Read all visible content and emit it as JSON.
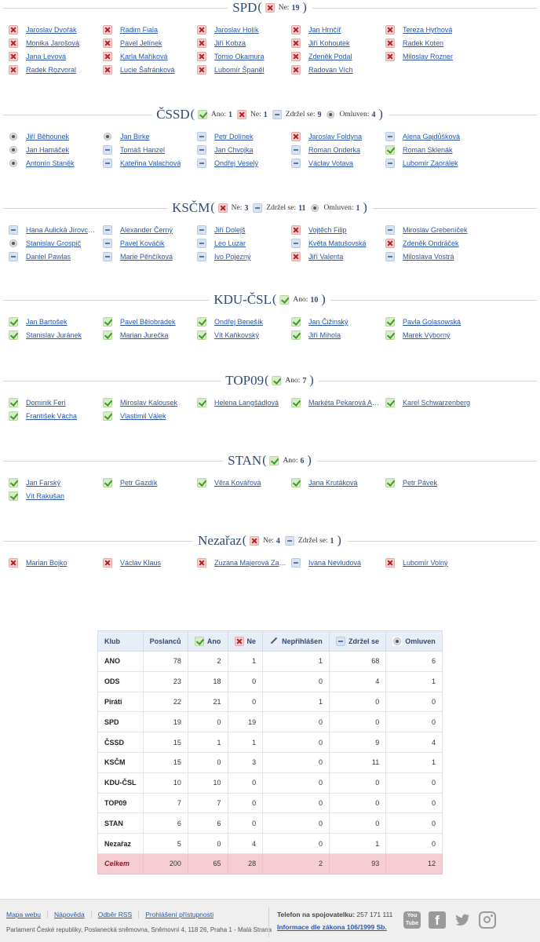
{
  "sections": [
    {
      "party": "SPD",
      "stats": [
        {
          "type": "no",
          "label": "Ne:",
          "value": "19"
        }
      ],
      "members": [
        {
          "name": "Jaroslav Dvořák",
          "vote": "no"
        },
        {
          "name": "Radim Fiala",
          "vote": "no"
        },
        {
          "name": "Jaroslav Holík",
          "vote": "no"
        },
        {
          "name": "Jan Hrnčíř",
          "vote": "no"
        },
        {
          "name": "Tereza Hyťhová",
          "vote": "no"
        },
        {
          "name": "Monika Jarošová",
          "vote": "no"
        },
        {
          "name": "Pavel Jelínek",
          "vote": "no"
        },
        {
          "name": "Jiří Kobza",
          "vote": "no"
        },
        {
          "name": "Jiří Kohoutek",
          "vote": "no"
        },
        {
          "name": "Radek Koten",
          "vote": "no"
        },
        {
          "name": "Jana Levová",
          "vote": "no"
        },
        {
          "name": "Karla Maříková",
          "vote": "no"
        },
        {
          "name": "Tomio Okamura",
          "vote": "no"
        },
        {
          "name": "Zdeněk Podal",
          "vote": "no"
        },
        {
          "name": "Miloslav Rozner",
          "vote": "no"
        },
        {
          "name": "Radek Rozvoral",
          "vote": "no"
        },
        {
          "name": "Lucie Šafránková",
          "vote": "no"
        },
        {
          "name": "Lubomír Španěl",
          "vote": "no"
        },
        {
          "name": "Radovan Vích",
          "vote": "no"
        }
      ]
    },
    {
      "party": "ČSSD",
      "stats": [
        {
          "type": "yes",
          "label": "Ano:",
          "value": "1"
        },
        {
          "type": "no",
          "label": "Ne:",
          "value": "1"
        },
        {
          "type": "abst",
          "label": "Zdržel se:",
          "value": "9"
        },
        {
          "type": "exc",
          "label": "Omluven:",
          "value": "4"
        }
      ],
      "members": [
        {
          "name": "Jiří Běhounek",
          "vote": "exc"
        },
        {
          "name": "Jan Birke",
          "vote": "exc"
        },
        {
          "name": "Petr Dolínek",
          "vote": "abst"
        },
        {
          "name": "Jaroslav Foldyna",
          "vote": "no"
        },
        {
          "name": "Alena Gajdůšková",
          "vote": "abst"
        },
        {
          "name": "Jan Hamáček",
          "vote": "exc"
        },
        {
          "name": "Tomáš Hanzel",
          "vote": "abst"
        },
        {
          "name": "Jan Chvojka",
          "vote": "abst"
        },
        {
          "name": "Roman Onderka",
          "vote": "abst"
        },
        {
          "name": "Roman Sklenák",
          "vote": "yes"
        },
        {
          "name": "Antonín Staněk",
          "vote": "exc"
        },
        {
          "name": "Kateřina Valachová",
          "vote": "abst"
        },
        {
          "name": "Ondřej Veselý",
          "vote": "abst"
        },
        {
          "name": "Václav Votava",
          "vote": "abst"
        },
        {
          "name": "Lubomír Zaorálek",
          "vote": "abst"
        }
      ]
    },
    {
      "party": "KSČM",
      "stats": [
        {
          "type": "no",
          "label": "Ne:",
          "value": "3"
        },
        {
          "type": "abst",
          "label": "Zdržel se:",
          "value": "11"
        },
        {
          "type": "exc",
          "label": "Omluven:",
          "value": "1"
        }
      ],
      "members": [
        {
          "name": "Hana Aulická Jírovcová",
          "vote": "abst"
        },
        {
          "name": "Alexander Černý",
          "vote": "abst"
        },
        {
          "name": "Jiří Dolejš",
          "vote": "abst"
        },
        {
          "name": "Vojtěch Filip",
          "vote": "no"
        },
        {
          "name": "Miroslav Grebeníček",
          "vote": "abst"
        },
        {
          "name": "Stanislav Grospič",
          "vote": "exc"
        },
        {
          "name": "Pavel Kováčik",
          "vote": "abst"
        },
        {
          "name": "Leo Luzar",
          "vote": "abst"
        },
        {
          "name": "Květa Matušovská",
          "vote": "abst"
        },
        {
          "name": "Zdeněk Ondráček",
          "vote": "no"
        },
        {
          "name": "Daniel Pawlas",
          "vote": "abst"
        },
        {
          "name": "Marie Pěnčíková",
          "vote": "abst"
        },
        {
          "name": "Ivo Pojezný",
          "vote": "abst"
        },
        {
          "name": "Jiří Valenta",
          "vote": "no"
        },
        {
          "name": "Miloslava Vostrá",
          "vote": "abst"
        }
      ]
    },
    {
      "party": "KDU-ČSL",
      "stats": [
        {
          "type": "yes",
          "label": "Ano:",
          "value": "10"
        }
      ],
      "members": [
        {
          "name": "Jan Bartošek",
          "vote": "yes"
        },
        {
          "name": "Pavel Bělobrádek",
          "vote": "yes"
        },
        {
          "name": "Ondřej Benešík",
          "vote": "yes"
        },
        {
          "name": "Jan Čižinský",
          "vote": "yes"
        },
        {
          "name": "Pavla Golasowská",
          "vote": "yes"
        },
        {
          "name": "Stanislav Juránek",
          "vote": "yes"
        },
        {
          "name": "Marian Jurečka",
          "vote": "yes"
        },
        {
          "name": "Vít Kaňkovský",
          "vote": "yes"
        },
        {
          "name": "Jiří Mihola",
          "vote": "yes"
        },
        {
          "name": "Marek Výborný",
          "vote": "yes"
        }
      ]
    },
    {
      "party": "TOP09",
      "stats": [
        {
          "type": "yes",
          "label": "Ano:",
          "value": "7"
        }
      ],
      "members": [
        {
          "name": "Dominik Feri",
          "vote": "yes"
        },
        {
          "name": "Miroslav Kalousek",
          "vote": "yes"
        },
        {
          "name": "Helena Langšádlová",
          "vote": "yes"
        },
        {
          "name": "Markéta Pekarová Adamová",
          "vote": "yes"
        },
        {
          "name": "Karel Schwarzenberg",
          "vote": "yes"
        },
        {
          "name": "František Vácha",
          "vote": "yes"
        },
        {
          "name": "Vlastimil Válek",
          "vote": "yes"
        }
      ]
    },
    {
      "party": "STAN",
      "stats": [
        {
          "type": "yes",
          "label": "Ano:",
          "value": "6"
        }
      ],
      "members": [
        {
          "name": "Jan Farský",
          "vote": "yes"
        },
        {
          "name": "Petr Gazdík",
          "vote": "yes"
        },
        {
          "name": "Věra Kovářová",
          "vote": "yes"
        },
        {
          "name": "Jana Krutáková",
          "vote": "yes"
        },
        {
          "name": "Petr Pávek",
          "vote": "yes"
        },
        {
          "name": "Vít Rakušan",
          "vote": "yes"
        }
      ]
    },
    {
      "party": "Nezařaz",
      "stats": [
        {
          "type": "no",
          "label": "Ne:",
          "value": "4"
        },
        {
          "type": "abst",
          "label": "Zdržel se:",
          "value": "1"
        }
      ],
      "members": [
        {
          "name": "Marian Bojko",
          "vote": "no"
        },
        {
          "name": "Václav Klaus",
          "vote": "no"
        },
        {
          "name": "Zuzana Majerová Zahradníková",
          "vote": "no"
        },
        {
          "name": "Ivana Nevludová",
          "vote": "abst"
        },
        {
          "name": "Lubomír Volný",
          "vote": "no"
        }
      ]
    }
  ],
  "summary": {
    "headers": [
      {
        "label": "Klub",
        "icon": ""
      },
      {
        "label": "Poslanců",
        "icon": ""
      },
      {
        "label": "Ano",
        "icon": "yes"
      },
      {
        "label": "Ne",
        "icon": "no"
      },
      {
        "label": "Nepřihlášen",
        "icon": "unreg"
      },
      {
        "label": "Zdržel se",
        "icon": "abst"
      },
      {
        "label": "Omluven",
        "icon": "exc"
      }
    ],
    "rows": [
      [
        "ANO",
        "78",
        "2",
        "1",
        "1",
        "68",
        "6"
      ],
      [
        "ODS",
        "23",
        "18",
        "0",
        "0",
        "4",
        "1"
      ],
      [
        "Piráti",
        "22",
        "21",
        "0",
        "1",
        "0",
        "0"
      ],
      [
        "SPD",
        "19",
        "0",
        "19",
        "0",
        "0",
        "0"
      ],
      [
        "ČSSD",
        "15",
        "1",
        "1",
        "0",
        "9",
        "4"
      ],
      [
        "KSČM",
        "15",
        "0",
        "3",
        "0",
        "11",
        "1"
      ],
      [
        "KDU-ČSL",
        "10",
        "10",
        "0",
        "0",
        "0",
        "0"
      ],
      [
        "TOP09",
        "7",
        "7",
        "0",
        "0",
        "0",
        "0"
      ],
      [
        "STAN",
        "6",
        "6",
        "0",
        "0",
        "0",
        "0"
      ],
      [
        "Nezařaz",
        "5",
        "0",
        "4",
        "0",
        "1",
        "0"
      ]
    ],
    "total": [
      "Celkem",
      "200",
      "65",
      "28",
      "2",
      "93",
      "12"
    ]
  },
  "footer": {
    "links": [
      "Mapa webu",
      "Nápověda",
      "Odběr RSS",
      "Prohlášení přístupnosti"
    ],
    "address": "Parlament České republiky, Poslanecká sněmovna, Sněmovní 4, 118 26, Praha 1 - Malá Strana",
    "phone_label": "Telefon na spojovatelku:",
    "phone": "257 171 111",
    "law_link": "Informace dle zákona 106/1999 Sb.",
    "social": [
      {
        "icon": "youtube-icon",
        "text": "You Tube"
      },
      {
        "icon": "facebook-icon",
        "text": "f"
      },
      {
        "icon": "twitter-icon",
        "text": ""
      },
      {
        "icon": "instagram-icon",
        "text": ""
      }
    ]
  }
}
